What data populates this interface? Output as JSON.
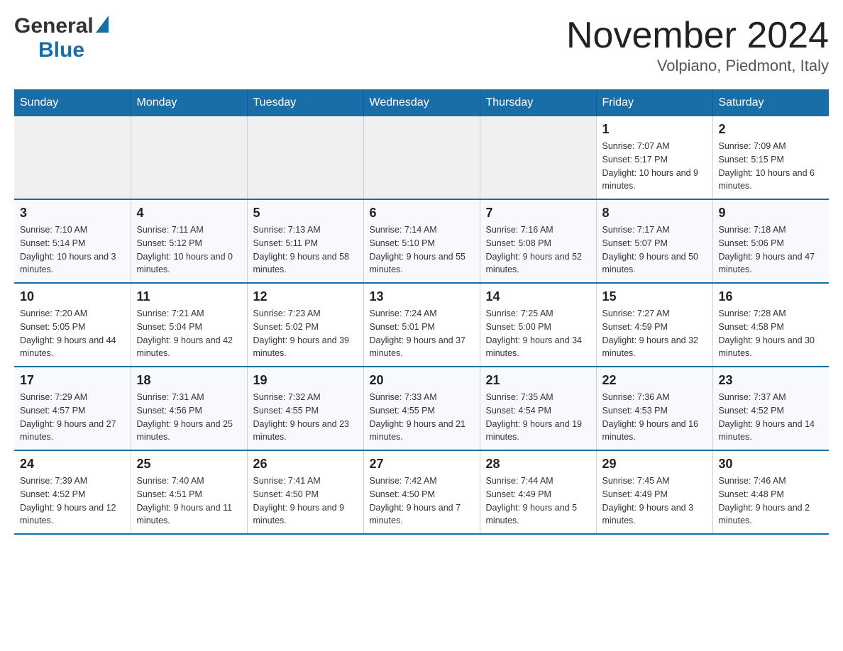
{
  "header": {
    "logo_text_general": "General",
    "logo_text_blue": "Blue",
    "month_title": "November 2024",
    "location": "Volpiano, Piedmont, Italy"
  },
  "days_of_week": [
    "Sunday",
    "Monday",
    "Tuesday",
    "Wednesday",
    "Thursday",
    "Friday",
    "Saturday"
  ],
  "weeks": [
    [
      {
        "day": "",
        "info": ""
      },
      {
        "day": "",
        "info": ""
      },
      {
        "day": "",
        "info": ""
      },
      {
        "day": "",
        "info": ""
      },
      {
        "day": "",
        "info": ""
      },
      {
        "day": "1",
        "info": "Sunrise: 7:07 AM\nSunset: 5:17 PM\nDaylight: 10 hours and 9 minutes."
      },
      {
        "day": "2",
        "info": "Sunrise: 7:09 AM\nSunset: 5:15 PM\nDaylight: 10 hours and 6 minutes."
      }
    ],
    [
      {
        "day": "3",
        "info": "Sunrise: 7:10 AM\nSunset: 5:14 PM\nDaylight: 10 hours and 3 minutes."
      },
      {
        "day": "4",
        "info": "Sunrise: 7:11 AM\nSunset: 5:12 PM\nDaylight: 10 hours and 0 minutes."
      },
      {
        "day": "5",
        "info": "Sunrise: 7:13 AM\nSunset: 5:11 PM\nDaylight: 9 hours and 58 minutes."
      },
      {
        "day": "6",
        "info": "Sunrise: 7:14 AM\nSunset: 5:10 PM\nDaylight: 9 hours and 55 minutes."
      },
      {
        "day": "7",
        "info": "Sunrise: 7:16 AM\nSunset: 5:08 PM\nDaylight: 9 hours and 52 minutes."
      },
      {
        "day": "8",
        "info": "Sunrise: 7:17 AM\nSunset: 5:07 PM\nDaylight: 9 hours and 50 minutes."
      },
      {
        "day": "9",
        "info": "Sunrise: 7:18 AM\nSunset: 5:06 PM\nDaylight: 9 hours and 47 minutes."
      }
    ],
    [
      {
        "day": "10",
        "info": "Sunrise: 7:20 AM\nSunset: 5:05 PM\nDaylight: 9 hours and 44 minutes."
      },
      {
        "day": "11",
        "info": "Sunrise: 7:21 AM\nSunset: 5:04 PM\nDaylight: 9 hours and 42 minutes."
      },
      {
        "day": "12",
        "info": "Sunrise: 7:23 AM\nSunset: 5:02 PM\nDaylight: 9 hours and 39 minutes."
      },
      {
        "day": "13",
        "info": "Sunrise: 7:24 AM\nSunset: 5:01 PM\nDaylight: 9 hours and 37 minutes."
      },
      {
        "day": "14",
        "info": "Sunrise: 7:25 AM\nSunset: 5:00 PM\nDaylight: 9 hours and 34 minutes."
      },
      {
        "day": "15",
        "info": "Sunrise: 7:27 AM\nSunset: 4:59 PM\nDaylight: 9 hours and 32 minutes."
      },
      {
        "day": "16",
        "info": "Sunrise: 7:28 AM\nSunset: 4:58 PM\nDaylight: 9 hours and 30 minutes."
      }
    ],
    [
      {
        "day": "17",
        "info": "Sunrise: 7:29 AM\nSunset: 4:57 PM\nDaylight: 9 hours and 27 minutes."
      },
      {
        "day": "18",
        "info": "Sunrise: 7:31 AM\nSunset: 4:56 PM\nDaylight: 9 hours and 25 minutes."
      },
      {
        "day": "19",
        "info": "Sunrise: 7:32 AM\nSunset: 4:55 PM\nDaylight: 9 hours and 23 minutes."
      },
      {
        "day": "20",
        "info": "Sunrise: 7:33 AM\nSunset: 4:55 PM\nDaylight: 9 hours and 21 minutes."
      },
      {
        "day": "21",
        "info": "Sunrise: 7:35 AM\nSunset: 4:54 PM\nDaylight: 9 hours and 19 minutes."
      },
      {
        "day": "22",
        "info": "Sunrise: 7:36 AM\nSunset: 4:53 PM\nDaylight: 9 hours and 16 minutes."
      },
      {
        "day": "23",
        "info": "Sunrise: 7:37 AM\nSunset: 4:52 PM\nDaylight: 9 hours and 14 minutes."
      }
    ],
    [
      {
        "day": "24",
        "info": "Sunrise: 7:39 AM\nSunset: 4:52 PM\nDaylight: 9 hours and 12 minutes."
      },
      {
        "day": "25",
        "info": "Sunrise: 7:40 AM\nSunset: 4:51 PM\nDaylight: 9 hours and 11 minutes."
      },
      {
        "day": "26",
        "info": "Sunrise: 7:41 AM\nSunset: 4:50 PM\nDaylight: 9 hours and 9 minutes."
      },
      {
        "day": "27",
        "info": "Sunrise: 7:42 AM\nSunset: 4:50 PM\nDaylight: 9 hours and 7 minutes."
      },
      {
        "day": "28",
        "info": "Sunrise: 7:44 AM\nSunset: 4:49 PM\nDaylight: 9 hours and 5 minutes."
      },
      {
        "day": "29",
        "info": "Sunrise: 7:45 AM\nSunset: 4:49 PM\nDaylight: 9 hours and 3 minutes."
      },
      {
        "day": "30",
        "info": "Sunrise: 7:46 AM\nSunset: 4:48 PM\nDaylight: 9 hours and 2 minutes."
      }
    ]
  ]
}
